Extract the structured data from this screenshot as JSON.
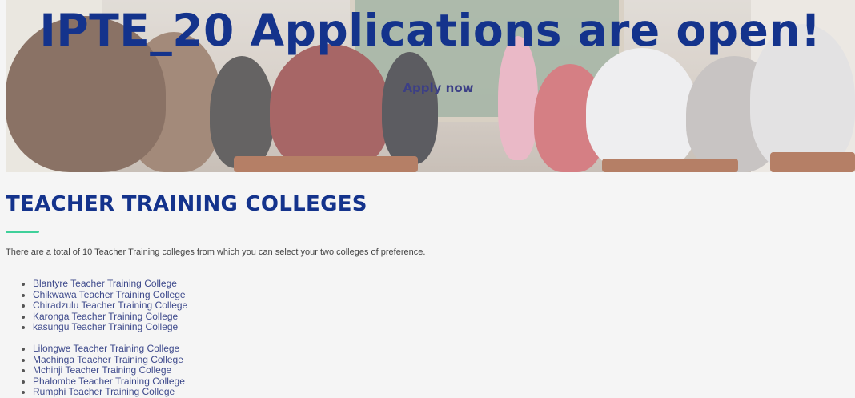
{
  "hero": {
    "title": "IPTE_20 Applications are open!",
    "cta_label": "Apply now"
  },
  "section": {
    "title": "TEACHER TRAINING COLLEGES",
    "intro": "There are a total of 10 Teacher Training colleges from which you can select your two colleges of preference."
  },
  "colleges_group_1": [
    "Blantyre Teacher Training College",
    "Chikwawa Teacher Training College",
    "Chiradzulu Teacher Training College",
    "Karonga Teacher Training College",
    "kasungu Teacher Training College"
  ],
  "colleges_group_2": [
    "Lilongwe Teacher Training College",
    "Machinga Teacher Training College",
    "Mchinji Teacher Training College",
    "Phalombe Teacher Training College",
    "Rumphi Teacher Training College"
  ],
  "colors": {
    "title_blue": "#14338c",
    "accent_green": "#3fd09a",
    "link_blue": "#3e4a8c"
  }
}
